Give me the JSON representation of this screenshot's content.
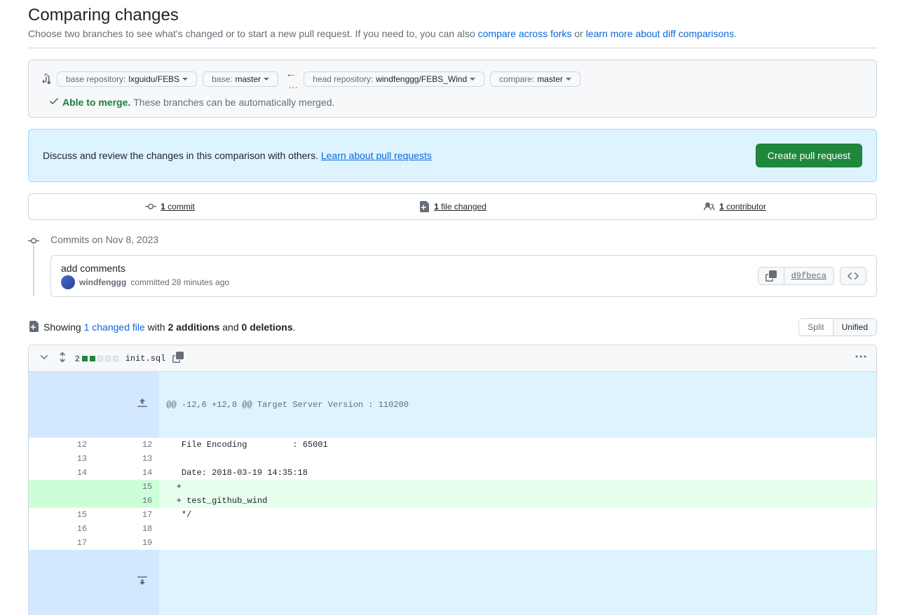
{
  "page": {
    "title": "Comparing changes",
    "subtitle_pre": "Choose two branches to see what's changed or to start a new pull request. If you need to, you can also ",
    "link_across_forks": "compare across forks",
    "subtitle_mid": " or ",
    "link_learn_diff": "learn more about diff comparisons",
    "subtitle_end": "."
  },
  "selectors": {
    "base_repo_label": "base repository: ",
    "base_repo_value": "lxguidu/FEBS",
    "base_branch_label": "base: ",
    "base_branch_value": "master",
    "head_repo_label": "head repository: ",
    "head_repo_value": "windfenggg/FEBS_Wind",
    "compare_branch_label": "compare: ",
    "compare_branch_value": "master",
    "ellipsis": "…"
  },
  "merge": {
    "status": "Able to merge.",
    "desc": "These branches can be automatically merged."
  },
  "banner": {
    "text": "Discuss and review the changes in this comparison with others. ",
    "link": "Learn about pull requests",
    "button": "Create pull request"
  },
  "stats": {
    "commits_count": "1",
    "commits_label": " commit",
    "files_count": "1",
    "files_label": " file changed",
    "contributors_count": "1",
    "contributors_label": " contributor"
  },
  "timeline": {
    "date": "Commits on Nov 8, 2023"
  },
  "commit": {
    "title": "add comments",
    "author": "windfenggg",
    "meta_suffix": " committed 28 minutes ago",
    "sha": "d9fbeca"
  },
  "diff_summary": {
    "prefix": "Showing ",
    "changed_link": "1 changed file",
    "mid1": " with ",
    "additions": "2 additions",
    "mid2": " and ",
    "deletions": "0 deletions",
    "end": "."
  },
  "view_toggle": {
    "split": "Split",
    "unified": "Unified"
  },
  "file": {
    "changes": "2",
    "name": "init.sql",
    "hunk": "@@ -12,6 +12,8 @@ Target Server Version : 110200",
    "rows": [
      {
        "old": "12",
        "new": "12",
        "type": "context",
        "text": " File Encoding         : 65001"
      },
      {
        "old": "13",
        "new": "13",
        "type": "context",
        "text": ""
      },
      {
        "old": "14",
        "new": "14",
        "type": "context",
        "text": " Date: 2018-03-19 14:35:18"
      },
      {
        "old": "",
        "new": "15",
        "type": "addition",
        "text": "+ "
      },
      {
        "old": "",
        "new": "16",
        "type": "addition",
        "text": "+ test_github_wind"
      },
      {
        "old": "15",
        "new": "17",
        "type": "context",
        "text": " */"
      },
      {
        "old": "16",
        "new": "18",
        "type": "context",
        "text": ""
      },
      {
        "old": "17",
        "new": "19",
        "type": "context",
        "text": ""
      }
    ]
  }
}
